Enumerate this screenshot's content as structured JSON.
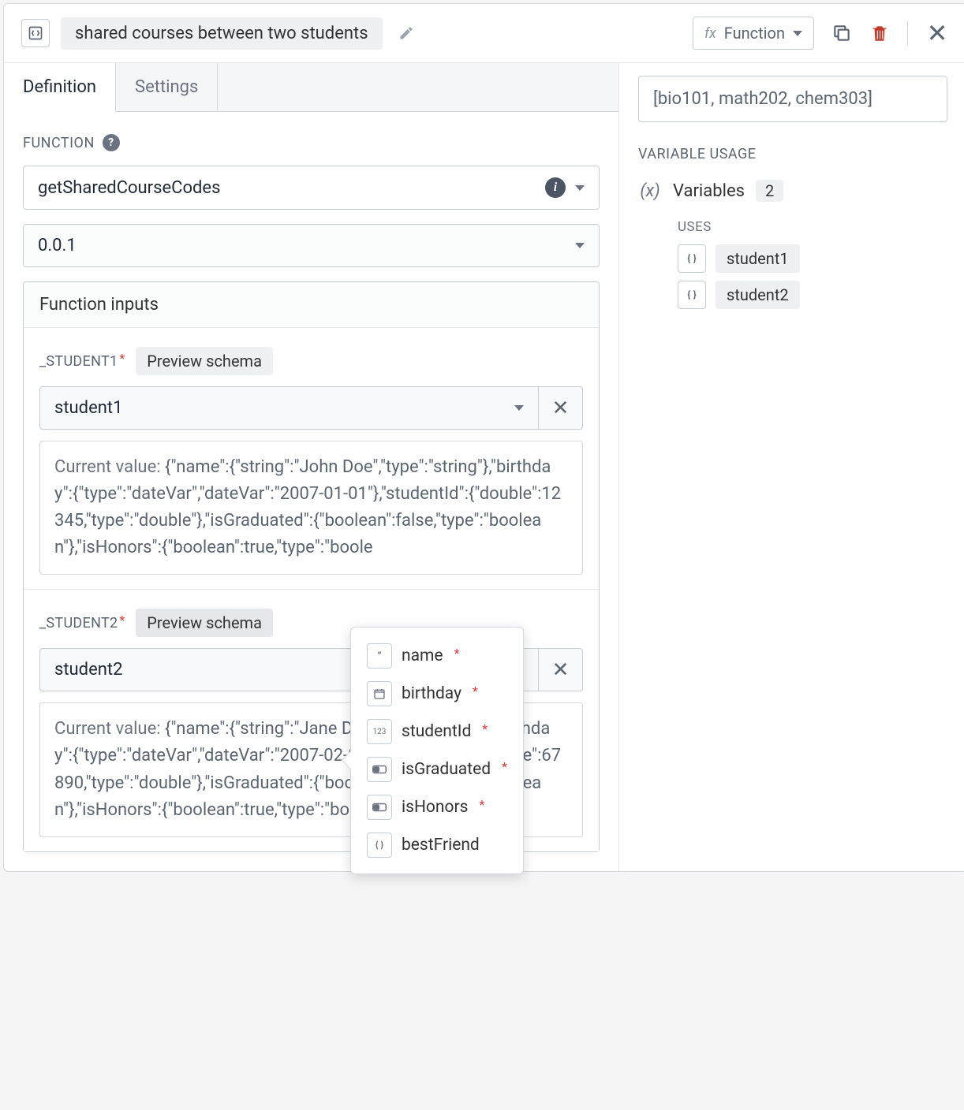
{
  "header": {
    "title": "shared courses between two students",
    "function_dropdown": "Function"
  },
  "tabs": {
    "definition": "Definition",
    "settings": "Settings"
  },
  "function": {
    "section_label": "FUNCTION",
    "name": "getSharedCourseCodes",
    "version": "0.0.1",
    "inputs_header": "Function inputs",
    "inputs": [
      {
        "label": "_STUDENT1",
        "preview": "Preview schema",
        "var": "student1",
        "current_label": "Current value: ",
        "current_value": "{\"name\":{\"string\":\"John Doe\",\"type\":\"string\"},\"birthday\":{\"type\":\"dateVar\",\"dateVar\":\"2007-01-01\"},\"studentId\":{\"double\":12345,\"type\":\"double\"},\"isGraduated\":{\"boolean\":false,\"type\":\"boolean\"},\"isHonors\":{\"boolean\":true,\"type\":\"boole"
      },
      {
        "label": "_STUDENT2",
        "preview": "Preview schema",
        "var": "student2",
        "current_label": "Current value: ",
        "current_value": "{\"name\":{\"string\":\"Jane Doe\",\"type\":\"string\"},\"birthday\":{\"type\":\"dateVar\",\"dateVar\":\"2007-02-02\"},\"studentId\":{\"double\":67890,\"type\":\"double\"},\"isGraduated\":{\"boolean\":false,\"type\":\"boolean\"},\"isHonors\":{\"boolean\":true,\"type\":\"boolean\"}}"
      }
    ]
  },
  "schema_popover": {
    "items": [
      {
        "icon": "string",
        "label": "name",
        "required": true
      },
      {
        "icon": "date",
        "label": "birthday",
        "required": true
      },
      {
        "icon": "number",
        "label": "studentId",
        "required": true
      },
      {
        "icon": "bool",
        "label": "isGraduated",
        "required": true
      },
      {
        "icon": "bool",
        "label": "isHonors",
        "required": true
      },
      {
        "icon": "object",
        "label": "bestFriend",
        "required": false
      }
    ]
  },
  "right": {
    "output": "[bio101, math202, chem303]",
    "vu_title": "VARIABLE USAGE",
    "vars_label": "Variables",
    "vars_count": "2",
    "uses_label": "USES",
    "uses": [
      "student1",
      "student2"
    ]
  }
}
